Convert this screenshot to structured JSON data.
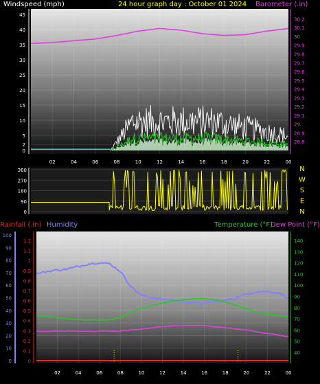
{
  "header": {
    "left": "Windspeed (mph)",
    "center": "24 hour graph day : October 01 2024",
    "right": "Barometer (.in)"
  },
  "colors": {
    "wind_gust": "#ffffff",
    "wind_avg": "#22cc22",
    "wind_fill": "#c8ecc8",
    "barometer": "#e040e0",
    "direction": "#ffff00",
    "rainfall": "#ff2020",
    "humidity": "#8080ff",
    "temperature": "#22cc22",
    "dew_point": "#e040e0"
  },
  "chart_data": [
    {
      "type": "line",
      "name": "wind_barometer",
      "x_ticks": [
        "02",
        "04",
        "06",
        "08",
        "10",
        "12",
        "14",
        "16",
        "18",
        "20",
        "22",
        "00"
      ],
      "y_left_ticks": [
        0,
        2,
        5,
        10,
        15,
        20,
        25,
        30,
        35,
        40,
        45
      ],
      "y_left_range": [
        0,
        45
      ],
      "y_right_ticks": [
        "28.8",
        "28.9",
        "29",
        "29.1",
        "29.2",
        "29.3",
        "29.4",
        "29.5",
        "29.6",
        "29.7",
        "29.8",
        "29.9",
        "30",
        "30.1",
        "30.2"
      ],
      "y_right_range": [
        28.7,
        30.25
      ],
      "barometer": {
        "x": [
          0,
          2,
          4,
          6,
          8,
          10,
          12,
          14,
          16,
          18,
          20,
          22,
          24
        ],
        "y": [
          29.92,
          29.93,
          29.95,
          29.97,
          30.01,
          30.06,
          30.09,
          30.07,
          30.03,
          30.01,
          30.02,
          30.06,
          30.09
        ]
      },
      "wind_start_hour": 7.4
    },
    {
      "type": "scatter",
      "name": "wind_direction",
      "y_left_ticks": [
        "360",
        "270",
        "180",
        "90",
        "0"
      ],
      "compass": [
        "N",
        "W",
        "S",
        "E",
        "N"
      ],
      "y_range": [
        0,
        360
      ],
      "before_change": 80,
      "change_hour": 7.3
    },
    {
      "type": "line",
      "name": "rain_humidity_temp_dew",
      "labels": {
        "rainfall": "Rainfall (.in)",
        "humidity": "Humidity",
        "temperature": "Temperature (°F)",
        "dew_point": "Dew Point (°F)"
      },
      "rain_ticks": [
        "0",
        "0.1",
        "0.2",
        "0.3",
        "0.4",
        "0.5",
        "0.6",
        "0.7",
        "0.8",
        "0.9",
        "1",
        "1.1",
        "1.2"
      ],
      "humidity_ticks": [
        "0",
        "10",
        "20",
        "30",
        "40",
        "50",
        "60",
        "70",
        "80",
        "90",
        "100"
      ],
      "temp_ticks": [
        "40",
        "50",
        "60",
        "70",
        "80",
        "90",
        "100",
        "110",
        "120",
        "130",
        "140"
      ],
      "x_ticks": [
        "02",
        "04",
        "06",
        "08",
        "10",
        "12",
        "14",
        "16",
        "18",
        "20",
        "22",
        "00"
      ],
      "humidity": {
        "x": [
          0,
          1,
          2,
          3,
          4,
          5,
          6,
          7,
          8,
          9,
          10,
          11,
          12,
          13,
          14,
          15,
          16,
          17,
          18,
          19,
          20,
          21,
          22,
          23,
          24
        ],
        "y": [
          69,
          71,
          72,
          73,
          75,
          77,
          78,
          77,
          71,
          59,
          52,
          50,
          49,
          48,
          47,
          46,
          46,
          47,
          48,
          50,
          53,
          55,
          55,
          54,
          50
        ]
      },
      "temperature": {
        "x": [
          0,
          1,
          2,
          3,
          4,
          5,
          6,
          7,
          8,
          9,
          10,
          11,
          12,
          13,
          14,
          15,
          16,
          17,
          18,
          19,
          20,
          21,
          22,
          23,
          24
        ],
        "y": [
          73,
          72,
          71,
          70,
          69,
          69,
          69,
          69,
          71,
          76,
          79,
          82,
          84,
          86,
          87,
          88,
          88,
          87,
          85,
          82,
          79,
          76,
          74,
          73,
          72
        ]
      },
      "dew_point": {
        "x": [
          0,
          2,
          4,
          6,
          8,
          10,
          12,
          14,
          16,
          18,
          20,
          22,
          24
        ],
        "y": [
          59,
          59,
          59,
          59,
          59,
          61,
          63,
          64,
          64,
          62,
          60,
          57,
          54
        ]
      },
      "rain_total": 0,
      "marker_hours": [
        7.4,
        19.2
      ]
    }
  ]
}
